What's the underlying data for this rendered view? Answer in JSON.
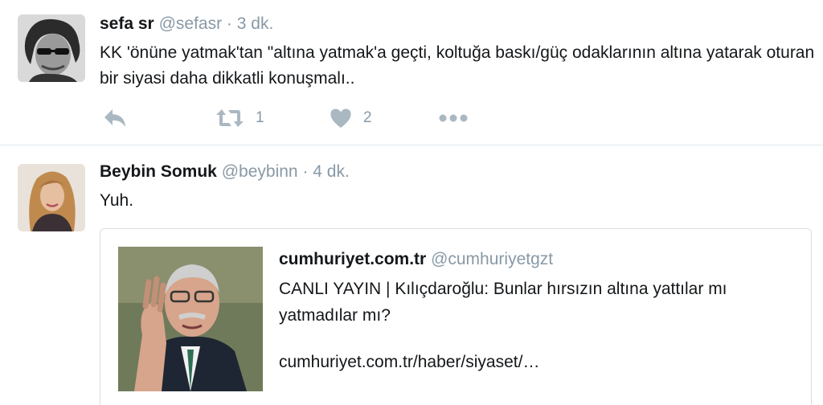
{
  "tweets": [
    {
      "name": "sefa sr",
      "handle": "@sefasr",
      "separator": "·",
      "time": "3 dk.",
      "text": "KK 'önüne yatmak'tan \"altına yatmak'a geçti, koltuğa baskı/güç odaklarının altına yatarak oturan bir siyasi daha dikkatli konuşmalı..",
      "retweets": "1",
      "likes": "2",
      "icons": [
        "reply-icon",
        "retweet-icon",
        "heart-icon",
        "more-icon"
      ]
    },
    {
      "name": "Beybin Somuk",
      "handle": "@beybinn",
      "separator": "·",
      "time": "4 dk.",
      "text": "Yuh.",
      "quote": {
        "name": "cumhuriyet.com.tr",
        "handle": "@cumhuriyetgzt",
        "text": "CANLI YAYIN | Kılıçdaroğlu: Bunlar hırsızın altına yattılar mı yatmadılar mı?",
        "link": "cumhuriyet.com.tr/haber/siyaset/…"
      }
    }
  ],
  "colors": {
    "text": "#14171a",
    "secondary": "#8899a6",
    "icon": "#aab8c2",
    "border": "#e1e8ed"
  }
}
